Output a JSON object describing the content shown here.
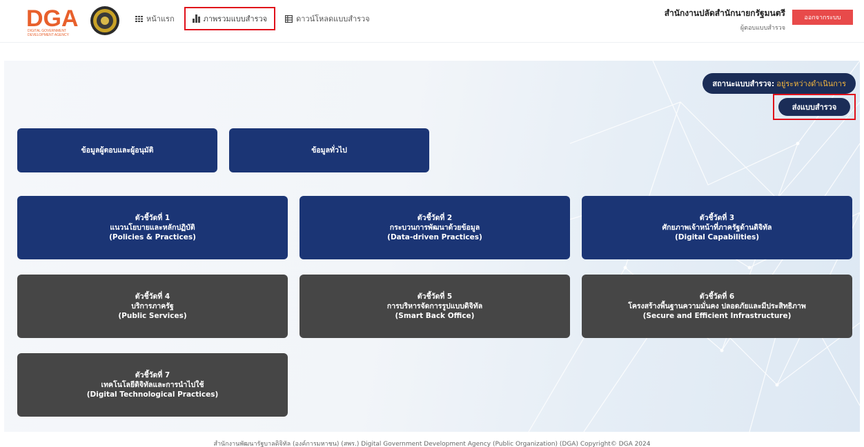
{
  "header": {
    "logo_text": "DGA",
    "logo_sub1": "DIGITAL GOVERNMENT",
    "logo_sub2": "DEVELOPMENT AGENCY",
    "nav": [
      {
        "label": "หน้าแรก",
        "icon": "grid-icon"
      },
      {
        "label": "ภาพรวมแบบสำรวจ",
        "icon": "bar-chart-icon"
      },
      {
        "label": "ดาวน์โหลดแบบสำรวจ",
        "icon": "table-icon"
      }
    ],
    "org_name": "สำนักงานปลัดสำนักนายกรัฐมนตรี",
    "role": "ผู้ตอบแบบสำรวจ",
    "logout_label": "ออกจากระบบ"
  },
  "status": {
    "label": "สถานะแบบสำรวจ:",
    "value": "อยู่ระหว่างดำเนินการ"
  },
  "submit_label": "ส่งแบบสำรวจ",
  "cards": {
    "respondent": "ข้อมูลผู้ตอบและผู้อนุมัติ",
    "general": "ข้อมูลทั่วไป",
    "ind1": {
      "title": "ตัวชี้วัดที่ 1",
      "th": "แนวนโยบายและหลักปฏิบัติ",
      "en": "(Policies & Practices)"
    },
    "ind2": {
      "title": "ตัวชี้วัดที่ 2",
      "th": "กระบวนการพัฒนาด้วยข้อมูล",
      "en": "(Data-driven Practices)"
    },
    "ind3": {
      "title": "ตัวชี้วัดที่ 3",
      "th": "ศักยภาพเจ้าหน้าที่ภาครัฐด้านดิจิทัล",
      "en": "(Digital Capabilities)"
    },
    "ind4": {
      "title": "ตัวชี้วัดที่ 4",
      "th": "บริการภาครัฐ",
      "en": "(Public Services)"
    },
    "ind5": {
      "title": "ตัวชี้วัดที่ 5",
      "th": "การบริหารจัดการรูปแบบดิจิทัล",
      "en": "(Smart Back Office)"
    },
    "ind6": {
      "title": "ตัวชี้วัดที่ 6",
      "th": "โครงสร้างพื้นฐานความมั่นคง ปลอดภัยและมีประสิทธิภาพ",
      "en": "(Secure and Efficient Infrastructure)"
    },
    "ind7": {
      "title": "ตัวชี้วัดที่ 7",
      "th": "เทคโนโลยีดิจิทัลและการนำไปใช้",
      "en": "(Digital Technological Practices)"
    }
  },
  "footer": "สำนักงานพัฒนารัฐบาลดิจิทัล (องค์การมหาชน) (สพร.) Digital Government Development Agency (Public Organization) (DGA) Copyright© DGA 2024",
  "colors": {
    "navy": "#1b3575",
    "card_grey": "#464646",
    "status_value": "#f4b63d",
    "logout_red": "#e84a4a",
    "highlight_red": "#e0101a"
  }
}
